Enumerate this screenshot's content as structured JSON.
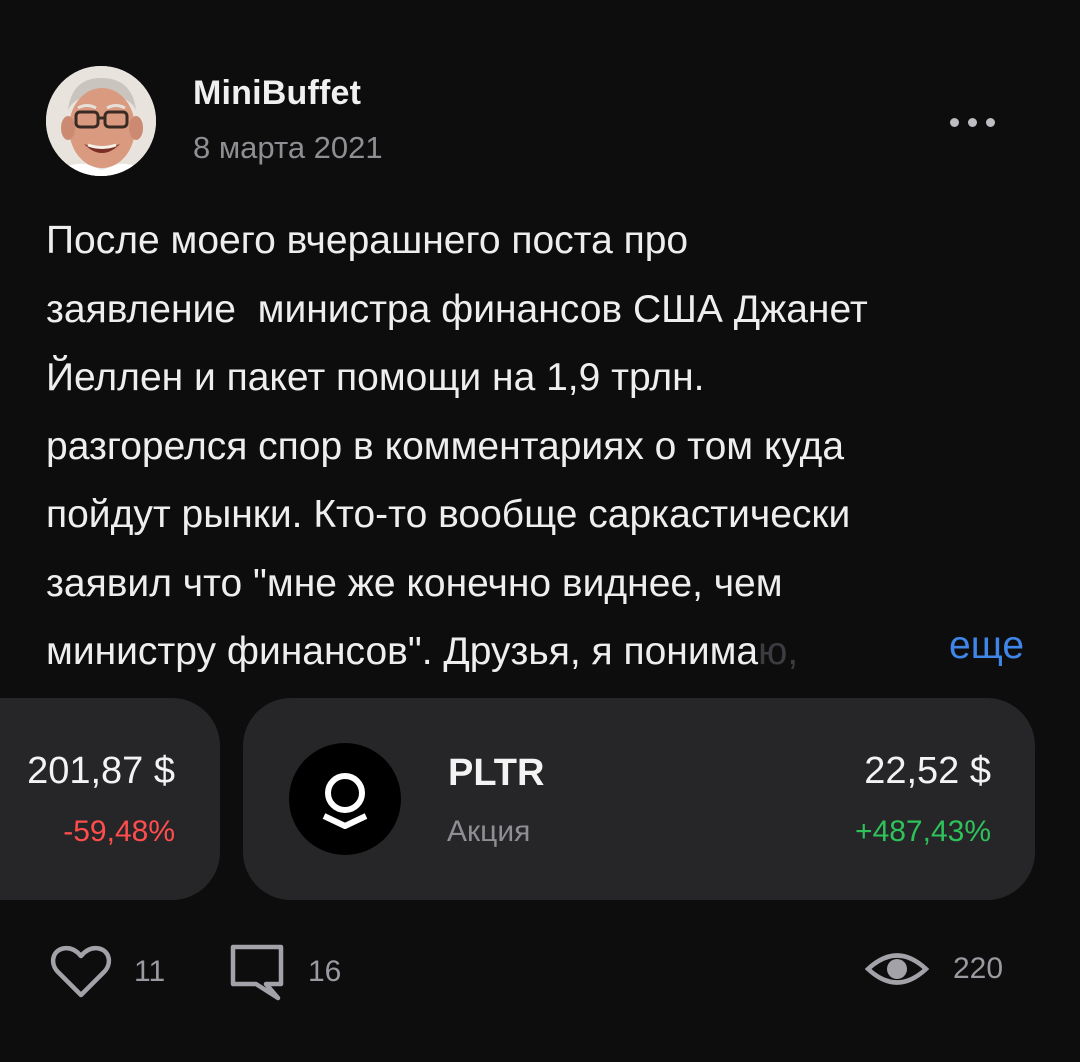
{
  "post": {
    "author": "MiniBuffet",
    "date": "8 марта 2021",
    "lines": [
      "После моего вчерашнего поста про",
      "заявление  министра финансов США Джанет",
      "Йеллен и пакет помощи на 1,9 трлн.",
      "разгорелся спор в комментариях о том куда",
      "пойдут рынки. Кто-то вообще саркастически",
      "заявил что \"мне же конечно виднее, чем"
    ],
    "last_line": "министру финансов\". Друзья, я понима",
    "last_line_faded": "ю,",
    "more_label": "еще"
  },
  "cards": {
    "prev": {
      "price": "201,87 $",
      "change": "-59,48%"
    },
    "main": {
      "symbol": "PLTR",
      "type": "Акция",
      "price": "22,52 $",
      "change": "+487,43%",
      "logo_icon": "palantir-logo-icon"
    }
  },
  "actions": {
    "likes": "11",
    "comments": "16",
    "views": "220"
  },
  "colors": {
    "background": "#0d0d0e",
    "card": "#262628",
    "link": "#3f86e8",
    "negative": "#ff4d4d",
    "positive": "#2ec25a",
    "muted": "#8e8e93"
  }
}
